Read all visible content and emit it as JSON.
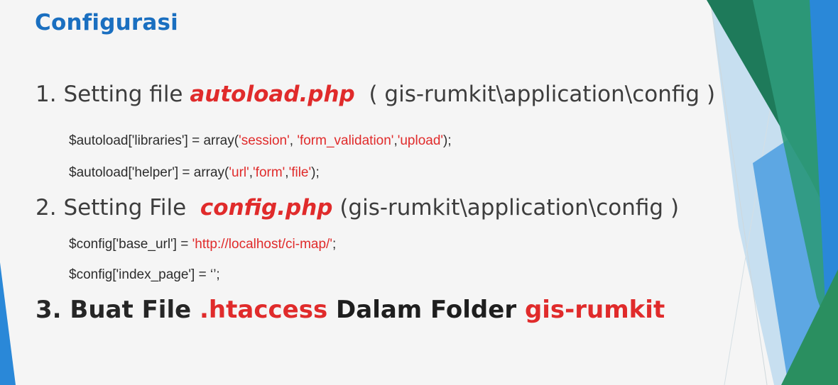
{
  "slide": {
    "title": "Configurasi",
    "items": [
      {
        "num": "1.",
        "prefix": "Setting file",
        "file": "autoload.php",
        "path": "( gis-rumkit\\application\\config )"
      },
      {
        "num": "2.",
        "prefix": "Setting File",
        "file": "config.php",
        "path": "(gis-rumkit\\application\\config )"
      },
      {
        "num": "3.",
        "prefix": "Buat File",
        "file": ".htaccess",
        "middle": "Dalam Folder",
        "folder": "gis-rumkit"
      }
    ],
    "code": {
      "line1": {
        "pre": "$autoload['libraries'] = array(",
        "s1": "'session'",
        "sep1": ", ",
        "s2": "'form_validation'",
        "sep2": ",",
        "s3": "'upload'",
        "post": ");"
      },
      "line2": {
        "pre": "$autoload['helper'] = array(",
        "s1": "'url'",
        "sep1": ",",
        "s2": "'form'",
        "sep2": ",",
        "s3": "'file'",
        "post": ");"
      },
      "line3": {
        "pre": "$config['base_url'] = ",
        "value": "'http://localhost/ci-map/'",
        "post": ";"
      },
      "line4": {
        "text": "$config['index_page'] = ‘’;"
      }
    },
    "colors": {
      "title": "#1a6fc0",
      "highlight": "#e02b2b",
      "body_text": "#3d3d3d",
      "deco_dark_green": "#1e7a5a",
      "deco_teal": "#2e9a7a",
      "deco_blue": "#2a88d8",
      "deco_light_blue": "#a9cce8"
    }
  }
}
